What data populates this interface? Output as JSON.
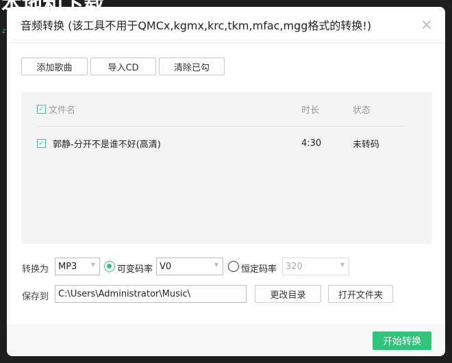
{
  "background": {
    "title": "本地和下载",
    "side": "z"
  },
  "dialog": {
    "title": "音频转换 (该工具不用于QMCx,kgmx,krc,tkm,mfac,mgg格式的转换!)",
    "close": "×"
  },
  "toolbar": {
    "add": "添加歌曲",
    "import_cd": "导入CD",
    "clear": "清除已勾"
  },
  "list": {
    "headers": {
      "name": "文件名",
      "duration": "时长",
      "status": "状态"
    },
    "rows": [
      {
        "checked": true,
        "name": "郭静-分开不是谁不好(高清)",
        "duration": "4:30",
        "status": "未转码"
      }
    ]
  },
  "convert": {
    "label": "转换为",
    "format": "MP3",
    "vbr_label": "可变码率",
    "vbr_value": "V0",
    "cbr_label": "恒定码率",
    "cbr_value": "320",
    "selected": "vbr"
  },
  "save": {
    "label": "保存到",
    "path": "C:\\Users\\Administrator\\Music\\",
    "change": "更改目录",
    "open": "打开文件夹"
  },
  "footer": {
    "start": "开始转换"
  },
  "colors": {
    "accent": "#31c27c"
  }
}
